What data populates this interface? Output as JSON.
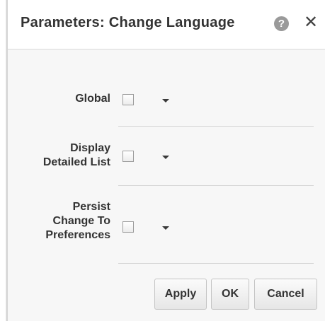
{
  "dialog": {
    "title": "Parameters: Change Language",
    "help_glyph": "?",
    "close_glyph": "✕",
    "icons": [
      "help-icon",
      "close-icon"
    ]
  },
  "parameters": [
    {
      "label_lines": [
        "Global"
      ],
      "checked": false
    },
    {
      "label_lines": [
        "Display",
        "Detailed List"
      ],
      "checked": false
    },
    {
      "label_lines": [
        "Persist",
        "Change To",
        "Preferences"
      ],
      "checked": false
    }
  ],
  "buttons": {
    "apply": "Apply",
    "ok": "OK",
    "cancel": "Cancel"
  },
  "colors": {
    "body_background": "#f7f7f7",
    "title_text": "#333333",
    "help_icon_bg": "#9a9a9a"
  }
}
